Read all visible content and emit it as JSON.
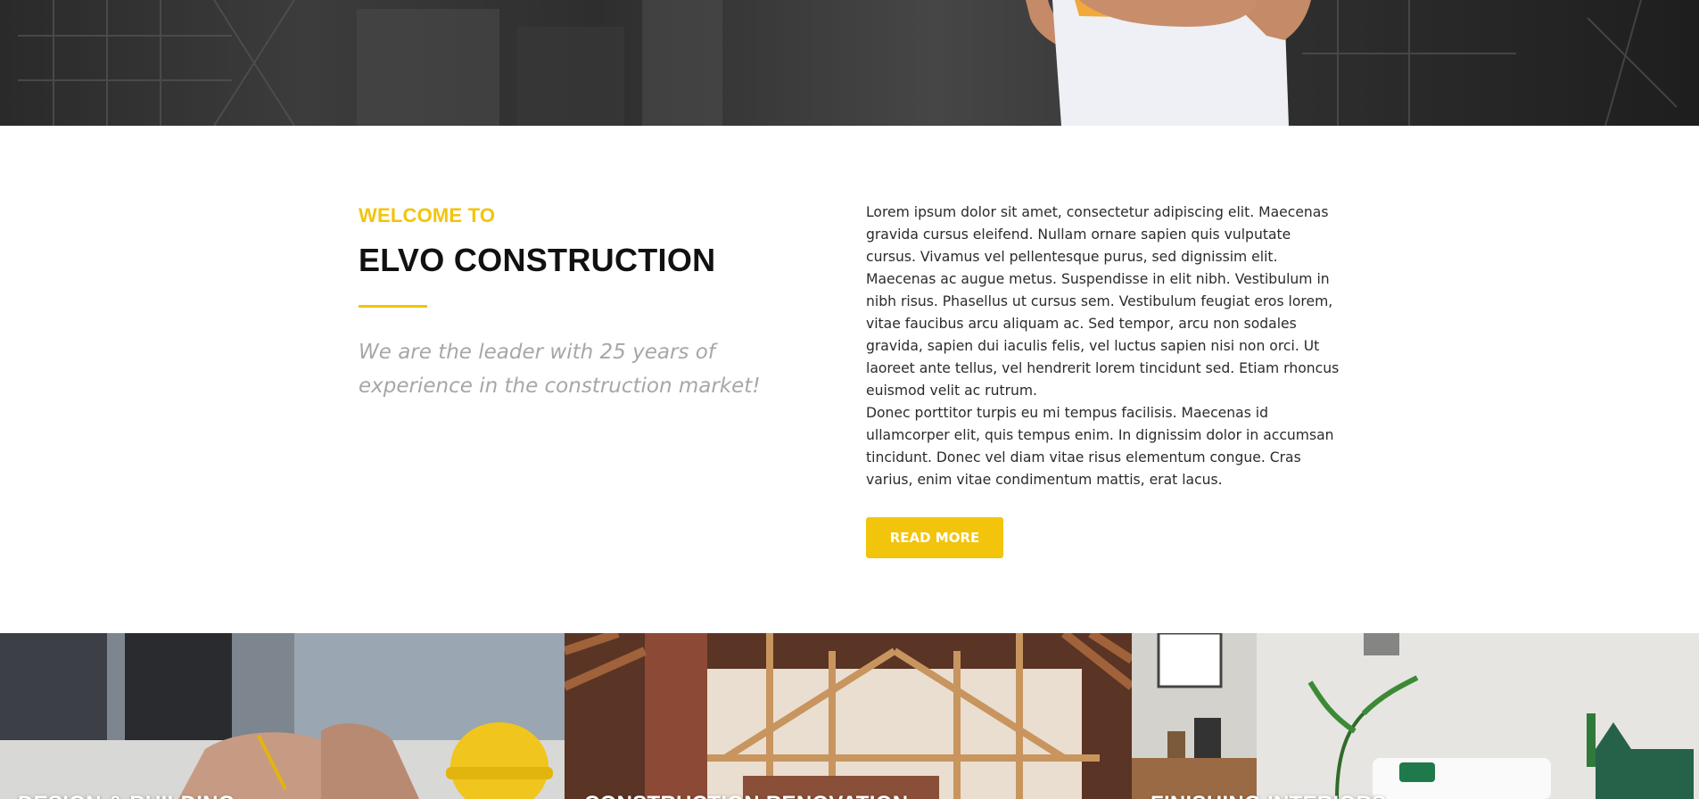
{
  "colors": {
    "accent": "#f2c40c",
    "heading": "#111111",
    "tagline": "#a7a7a7",
    "body": "#2b2b2b",
    "button_text": "#ffffff"
  },
  "hero": {
    "image": "construction-worker-photo"
  },
  "welcome": {
    "eyebrow": "WELCOME TO",
    "title": "ELVO CONSTRUCTION",
    "tagline": "We are the leader with 25 years of experience in the construction market!",
    "paragraph_1": "Lorem ipsum dolor sit amet, consectetur adipiscing elit. Maecenas gravida cursus eleifend. Nullam ornare sapien quis vulputate cursus. Vivamus vel pellentesque purus, sed dignissim elit. Maecenas ac augue metus. Suspendisse in elit nibh. Vestibulum in nibh risus. Phasellus ut cursus sem. Vestibulum feugiat eros lorem, vitae faucibus arcu aliquam ac. Sed tempor, arcu non sodales gravida, sapien dui iaculis felis, vel luctus sapien nisi non orci. Ut laoreet ante tellus, vel hendrerit lorem tincidunt sed. Etiam rhoncus euismod velit ac rutrum.",
    "paragraph_2": "Donec porttitor turpis eu mi tempus facilisis. Maecenas id ullamcorper elit, quis tempus enim. In dignissim dolor in accumsan tincidunt. Donec vel diam vitae risus elementum congue. Cras varius, enim vitae condimentum mattis, erat lacus.",
    "button_label": "READ MORE"
  },
  "services": [
    {
      "title": "DESIGN & BUILDING",
      "image": "blueprints-hardhat-photo"
    },
    {
      "title": "CONSTRUCTION RENOVATION",
      "image": "attic-renovation-photo"
    },
    {
      "title": "FINISHING INTERIORS",
      "image": "interior-living-room-photo"
    }
  ]
}
